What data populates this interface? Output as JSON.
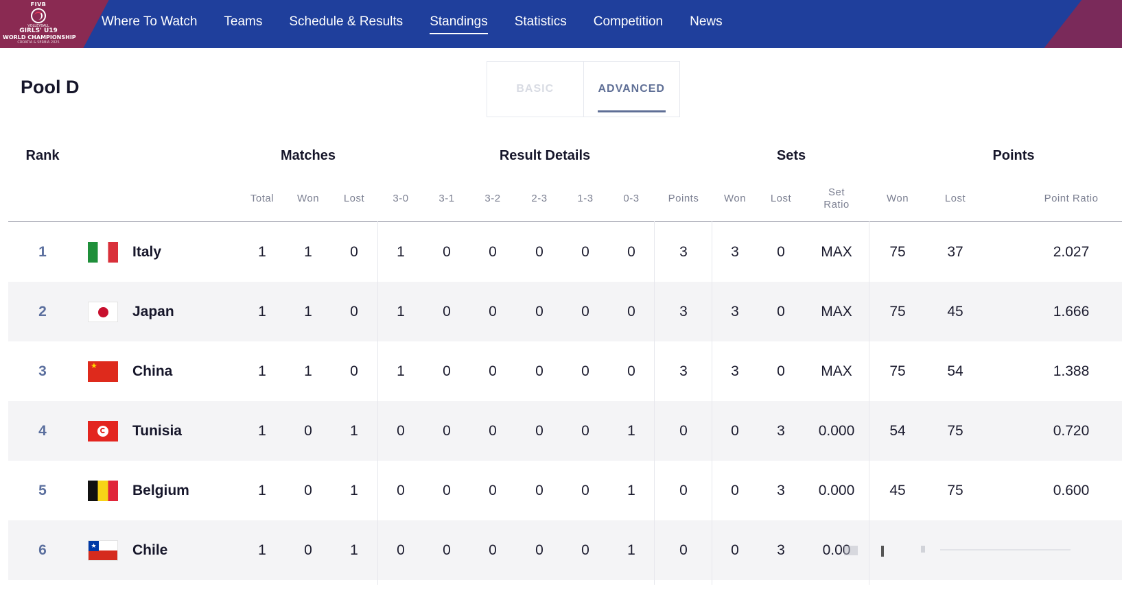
{
  "logo": {
    "fivb": "FIVB",
    "line1": "VOLLEYBALL",
    "line2": "GIRLS' U19",
    "line3": "WORLD CHAMPIONSHIP",
    "line4": "CROATIA & SERBIA 2025"
  },
  "nav": {
    "items": [
      "Where To Watch",
      "Teams",
      "Schedule & Results",
      "Standings",
      "Statistics",
      "Competition",
      "News"
    ],
    "active": "Standings"
  },
  "pool_title": "Pool D",
  "tabs": {
    "basic": "BASIC",
    "advanced": "ADVANCED",
    "active": "ADVANCED"
  },
  "groups": {
    "rank": "Rank",
    "matches": "Matches",
    "results": "Result Details",
    "sets": "Sets",
    "points": "Points"
  },
  "columns": {
    "total": "Total",
    "won": "Won",
    "lost": "Lost",
    "r30": "3-0",
    "r31": "3-1",
    "r32": "3-2",
    "r23": "2-3",
    "r13": "1-3",
    "r03": "0-3",
    "points": "Points",
    "sets_won": "Won",
    "sets_lost": "Lost",
    "set_ratio_1": "Set",
    "set_ratio_2": "Ratio",
    "pts_won": "Won",
    "pts_lost": "Lost",
    "point_ratio": "Point Ratio"
  },
  "rows": [
    {
      "rank": "1",
      "team": "Italy",
      "flag": "italy-flag-icon",
      "total": "1",
      "won": "1",
      "lost": "0",
      "r30": "1",
      "r31": "0",
      "r32": "0",
      "r23": "0",
      "r13": "0",
      "r03": "0",
      "points": "3",
      "sets_won": "3",
      "sets_lost": "0",
      "set_ratio": "MAX",
      "pts_won": "75",
      "pts_lost": "37",
      "point_ratio": "2.027"
    },
    {
      "rank": "2",
      "team": "Japan",
      "flag": "japan-flag-icon",
      "total": "1",
      "won": "1",
      "lost": "0",
      "r30": "1",
      "r31": "0",
      "r32": "0",
      "r23": "0",
      "r13": "0",
      "r03": "0",
      "points": "3",
      "sets_won": "3",
      "sets_lost": "0",
      "set_ratio": "MAX",
      "pts_won": "75",
      "pts_lost": "45",
      "point_ratio": "1.666"
    },
    {
      "rank": "3",
      "team": "China",
      "flag": "china-flag-icon",
      "total": "1",
      "won": "1",
      "lost": "0",
      "r30": "1",
      "r31": "0",
      "r32": "0",
      "r23": "0",
      "r13": "0",
      "r03": "0",
      "points": "3",
      "sets_won": "3",
      "sets_lost": "0",
      "set_ratio": "MAX",
      "pts_won": "75",
      "pts_lost": "54",
      "point_ratio": "1.388"
    },
    {
      "rank": "4",
      "team": "Tunisia",
      "flag": "tunisia-flag-icon",
      "total": "1",
      "won": "0",
      "lost": "1",
      "r30": "0",
      "r31": "0",
      "r32": "0",
      "r23": "0",
      "r13": "0",
      "r03": "1",
      "points": "0",
      "sets_won": "0",
      "sets_lost": "3",
      "set_ratio": "0.000",
      "pts_won": "54",
      "pts_lost": "75",
      "point_ratio": "0.720"
    },
    {
      "rank": "5",
      "team": "Belgium",
      "flag": "belgium-flag-icon",
      "total": "1",
      "won": "0",
      "lost": "1",
      "r30": "0",
      "r31": "0",
      "r32": "0",
      "r23": "0",
      "r13": "0",
      "r03": "1",
      "points": "0",
      "sets_won": "0",
      "sets_lost": "3",
      "set_ratio": "0.000",
      "pts_won": "45",
      "pts_lost": "75",
      "point_ratio": "0.600"
    },
    {
      "rank": "6",
      "team": "Chile",
      "flag": "chile-flag-icon",
      "total": "1",
      "won": "0",
      "lost": "1",
      "r30": "0",
      "r31": "0",
      "r32": "0",
      "r23": "0",
      "r13": "0",
      "r03": "1",
      "points": "0",
      "sets_won": "0",
      "sets_lost": "3",
      "set_ratio": "0.00",
      "pts_won": "",
      "pts_lost": "",
      "point_ratio": ""
    }
  ],
  "colors": {
    "header_bg": "#1f3f9c",
    "accent": "#5f6f96",
    "rank": "#5b6f9e",
    "alt_row": "#f4f4f6"
  }
}
